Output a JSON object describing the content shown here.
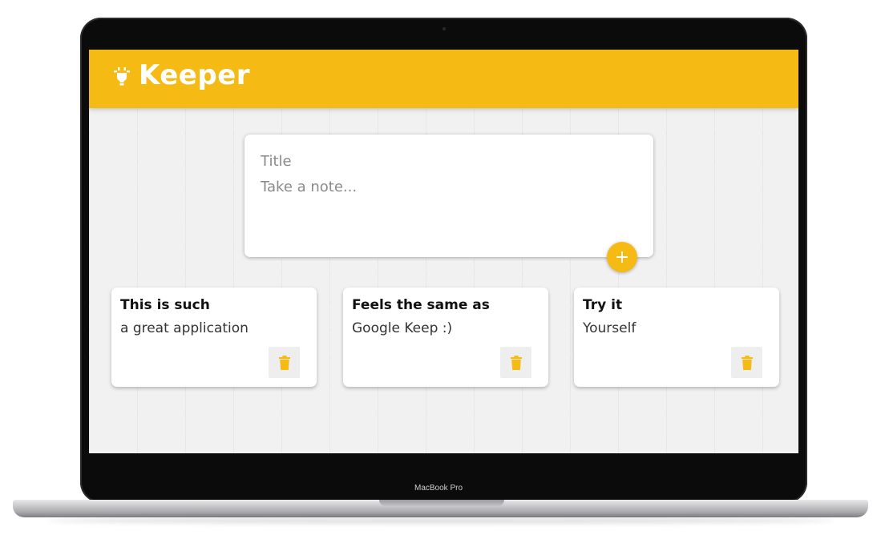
{
  "app": {
    "title": "Keeper",
    "brand_color": "#f5ba13",
    "logo_icon": "lightbulb-icon"
  },
  "create_note": {
    "title_placeholder": "Title",
    "content_placeholder": "Take a note...",
    "add_icon": "plus-icon"
  },
  "notes": [
    {
      "title": "This is such",
      "content": "a great application",
      "delete_icon": "trash-icon"
    },
    {
      "title": "Feels the same as",
      "content": "Google Keep :)",
      "delete_icon": "trash-icon"
    },
    {
      "title": "Try it",
      "content": "Yourself",
      "delete_icon": "trash-icon"
    }
  ],
  "device": {
    "label": "MacBook Pro"
  }
}
